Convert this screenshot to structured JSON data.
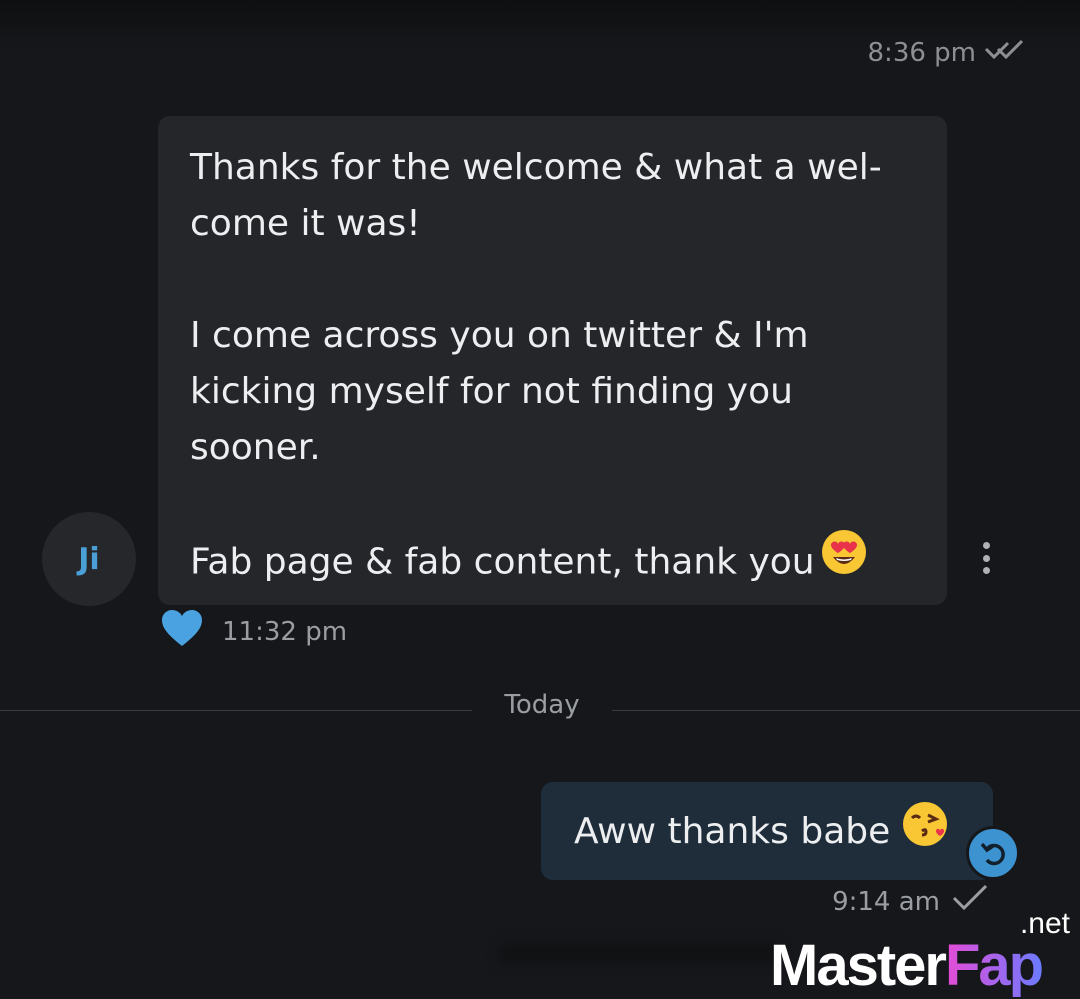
{
  "previous_message": {
    "time": "8:36 pm",
    "status_icon": "double-check-icon"
  },
  "contact": {
    "avatar_initials": "Ji"
  },
  "incoming_message": {
    "paragraphs": [
      "Thanks for the welcome & what a wel-come it was!",
      "I come across you on twitter & I'm kicking myself for not finding you sooner.",
      "Fab page & fab content, thank you"
    ],
    "emoji": "heart-eyes-emoji",
    "time": "11:32 pm",
    "reaction_icon": "heart-icon",
    "reaction_color": "#4aa3e0",
    "more_icon": "more-vertical-icon"
  },
  "date_separator": "Today",
  "outgoing_message": {
    "text": "Aww thanks babe",
    "emoji": "kissing-face-emoji",
    "time": "9:14 am",
    "status_icon": "check-icon",
    "badge_icon": "undo-icon",
    "badge_color": "#3d93d0"
  },
  "watermark": {
    "brand_part1": "Master",
    "brand_part2": "Fap",
    "suffix": ".net"
  }
}
